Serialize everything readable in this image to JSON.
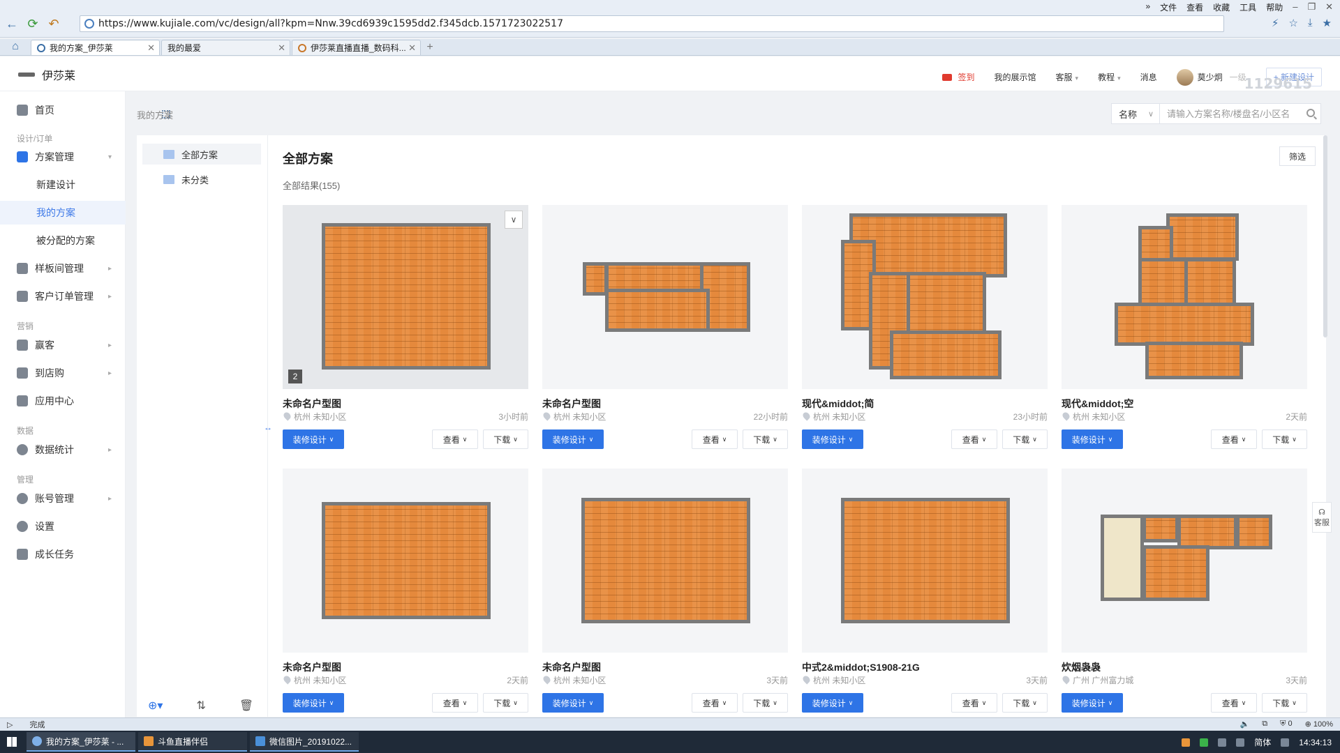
{
  "browser": {
    "url": "https://www.kujiale.com/vc/design/all?kpm=Nnw.39cd6939c1595dd2.f345dcb.1571723022517",
    "menu": [
      "»",
      "文件",
      "查看",
      "收藏",
      "工具",
      "帮助"
    ],
    "tabs": [
      {
        "label": "我的方案_伊莎莱"
      },
      {
        "label": "我的最爱"
      },
      {
        "label": "伊莎莱直播直播_数码科..."
      }
    ]
  },
  "header": {
    "brand": "伊莎莱",
    "sign_in": "签到",
    "showroom": "我的展示馆",
    "service": "客服",
    "tutorial": "教程",
    "messages": "消息",
    "username": "莫少炯",
    "level": "一级",
    "new_design": "+ 新建设计",
    "watermark": "1129615"
  },
  "sidebar": {
    "home": "首页",
    "group_design": "设计/订单",
    "plan_mgmt": "方案管理",
    "new_design": "新建设计",
    "my_plans": "我的方案",
    "assigned_plans": "被分配的方案",
    "sample_room": "样板间管理",
    "customer_orders": "客户订单管理",
    "group_marketing": "营销",
    "customers": "赢客",
    "store_visit": "到店购",
    "app_center": "应用中心",
    "group_data": "数据",
    "data_stats": "数据统计",
    "group_manage": "管理",
    "account_mgmt": "账号管理",
    "settings": "设置",
    "growth_tasks": "成长任务"
  },
  "main": {
    "breadcrumb": "我的方案",
    "search_type": "名称",
    "search_placeholder": "请输入方案名称/楼盘名/小区名",
    "folders": {
      "all": "全部方案",
      "uncategorized": "未分类"
    },
    "title": "全部方案",
    "result_count": "全部结果(155)",
    "filter": "筛选"
  },
  "card_labels": {
    "design": "装修设计",
    "view": "查看",
    "download": "下载"
  },
  "cards": [
    {
      "name": "未命名户型图",
      "location": "杭州 未知小区",
      "time": "3小时前",
      "badge": "2"
    },
    {
      "name": "未命名户型图",
      "location": "杭州 未知小区",
      "time": "22小时前"
    },
    {
      "name": "现代&middot;简",
      "location": "杭州 未知小区",
      "time": "23小时前"
    },
    {
      "name": "现代&middot;空",
      "location": "杭州 未知小区",
      "time": "2天前"
    },
    {
      "name": "未命名户型图",
      "location": "杭州 未知小区",
      "time": "2天前"
    },
    {
      "name": "未命名户型图",
      "location": "杭州 未知小区",
      "time": "3天前"
    },
    {
      "name": "中式2&middot;S1908-21G",
      "location": "杭州 未知小区",
      "time": "3天前"
    },
    {
      "name": "炊烟袅袅",
      "location": "广州 广州富力城",
      "time": "3天前"
    }
  ],
  "float_service": "客服",
  "status": {
    "text": "完成",
    "zoom": "100%",
    "count": "0"
  },
  "taskbar": {
    "tasks": [
      "我的方案_伊莎莱 - ...",
      "斗鱼直播伴侣",
      "微信图片_20191022..."
    ],
    "ime": "简体",
    "clock": "14:34:13"
  }
}
